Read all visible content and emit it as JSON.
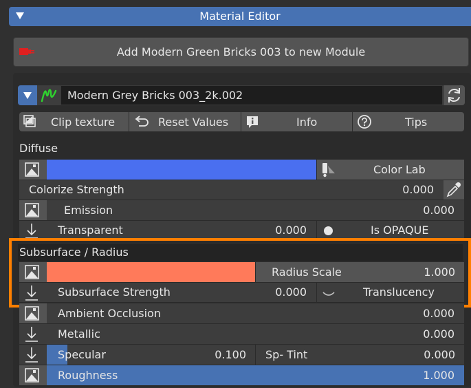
{
  "panel": {
    "title": "Material Editor"
  },
  "add_button": {
    "label": "Add Modern Green Bricks 003 to new Module"
  },
  "material": {
    "name": "Modern Grey Bricks 003_2k.002"
  },
  "toolbar": {
    "clip": "Clip texture",
    "reset": "Reset Values",
    "info": "Info",
    "tips": "Tips"
  },
  "diffuse": {
    "label": "Diffuse",
    "color": "#4a6ff0",
    "color_lab": "Color Lab",
    "colorize_label": "Colorize Strength",
    "colorize_value": "0.000",
    "emission_label": "Emission",
    "emission_value": "0.000",
    "transparent_label": "Transparent",
    "transparent_value": "0.000",
    "is_opaque": "Is OPAQUE"
  },
  "subsurface": {
    "label": "Subsurface / Radius",
    "color": "#ff7a5a",
    "radius_label": "Radius Scale",
    "radius_value": "1.000",
    "strength_label": "Subsurface Strength",
    "strength_value": "0.000",
    "translucency": "Translucency"
  },
  "ao": {
    "label": "Ambient Occlusion",
    "value": "0.000"
  },
  "metallic": {
    "label": "Metallic",
    "value": "0.000"
  },
  "specular": {
    "label": "Specular",
    "value": "0.100",
    "fill": 0.1,
    "tint_label": "Sp- Tint",
    "tint_value": "0.000"
  },
  "roughness": {
    "label": "Roughness",
    "value": "1.000",
    "fill": 1.0
  },
  "colors": {
    "accent": "#4772b3",
    "highlight": "#ff7f00"
  }
}
